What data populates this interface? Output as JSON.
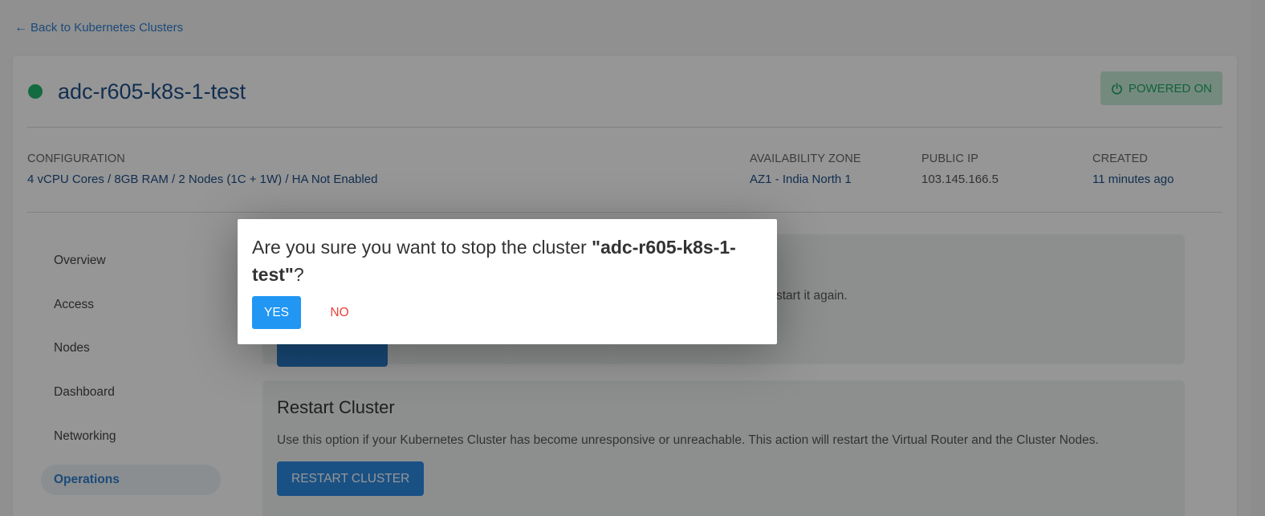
{
  "back_link": {
    "icon": "arrow-left-icon",
    "label": "Back to Kubernetes Clusters"
  },
  "cluster": {
    "name": "adc-r605-k8s-1-test",
    "status_color": "#21b76b",
    "power_badge": {
      "icon": "power-icon",
      "label": "POWERED ON",
      "color": "#1ea664"
    }
  },
  "info": {
    "configuration": {
      "label": "CONFIGURATION",
      "value": "4 vCPU Cores / 8GB RAM / 2 Nodes (1C + 1W) / HA Not Enabled"
    },
    "availability_zone": {
      "label": "AVAILABILITY ZONE",
      "value": "AZ1 - India North 1"
    },
    "public_ip": {
      "label": "PUBLIC IP",
      "value": "103.145.166.5"
    },
    "created": {
      "label": "CREATED",
      "value": "11 minutes ago"
    }
  },
  "sidenav": {
    "items": [
      {
        "label": "Overview",
        "active": false
      },
      {
        "label": "Access",
        "active": false
      },
      {
        "label": "Nodes",
        "active": false
      },
      {
        "label": "Dashboard",
        "active": false
      },
      {
        "label": "Networking",
        "active": false
      },
      {
        "label": "Operations",
        "active": true
      }
    ]
  },
  "operations": {
    "stop_section": {
      "description_fragment": "start it again."
    },
    "restart_section": {
      "title": "Restart Cluster",
      "description": "Use this option if your Kubernetes Cluster has become unresponsive or unreachable. This action will restart the Virtual Router and the Cluster Nodes.",
      "button_label": "RESTART CLUSTER"
    }
  },
  "modal": {
    "message_prefix": "Are you sure you want to stop the cluster ",
    "cluster_name_quoted": "\"adc-r605-k8s-1-test\"",
    "message_suffix": "?",
    "yes_label": "YES",
    "no_label": "NO",
    "yes_color": "#2196f3",
    "no_color": "#e8413a"
  }
}
